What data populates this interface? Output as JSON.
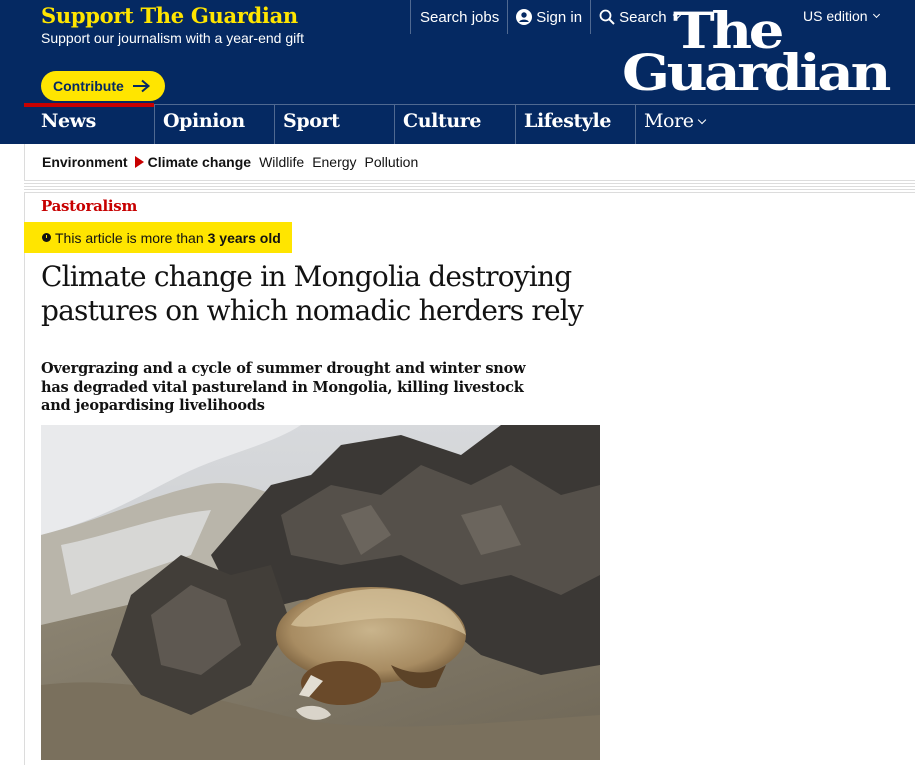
{
  "support": {
    "title": "Support The Guardian",
    "subtitle": "Support our journalism with a year-end gift",
    "contribute_label": "Contribute"
  },
  "top_links": {
    "jobs": "Search jobs",
    "sign_in": "Sign in",
    "search": "Search",
    "edition": "US edition"
  },
  "logo": {
    "line1": "The",
    "line2": "Guardian"
  },
  "pillars": [
    {
      "label": "News"
    },
    {
      "label": "Opinion"
    },
    {
      "label": "Sport"
    },
    {
      "label": "Culture"
    },
    {
      "label": "Lifestyle"
    },
    {
      "label": "More"
    }
  ],
  "subnav": {
    "section": "Environment",
    "current": "Climate change",
    "items": [
      "Wildlife",
      "Energy",
      "Pollution"
    ]
  },
  "article": {
    "kicker": "Pastoralism",
    "age_prefix": "This article is more than",
    "age_value": "3 years old",
    "headline": "Climate change in Mongolia destroying pastures on which nomadic herders rely",
    "standfirst": "Overgrazing and a cycle of summer drought and winter snow has degraded vital pastureland in Mongolia, killing livestock and jeopardising livelihoods"
  },
  "colors": {
    "brand_blue": "#052962",
    "support_yellow": "#ffe500",
    "news_red": "#c70000"
  },
  "icons": {
    "arrow": "arrow-right-icon",
    "account": "user-icon",
    "search": "magnifier-icon",
    "clock": "clock-icon",
    "chevron": "chevron-down-icon"
  }
}
